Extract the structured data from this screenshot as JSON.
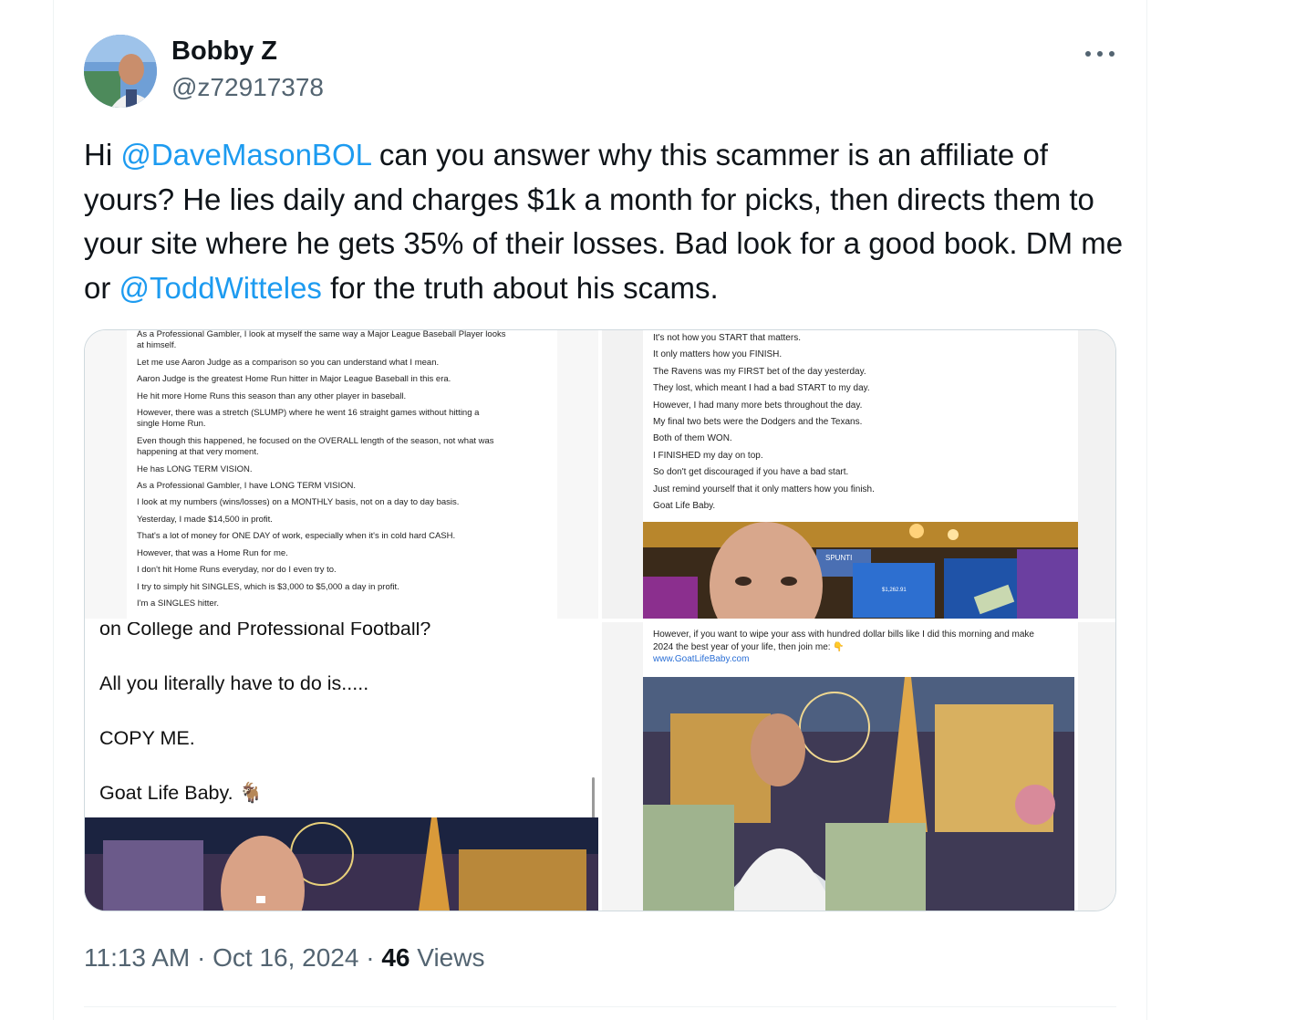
{
  "author": {
    "name": "Bobby Z",
    "handle": "@z72917378",
    "avatar_icon": "avatar-photo"
  },
  "tweet": {
    "text_before": "Hi ",
    "mention1": "@DaveMasonBOL",
    "text_middle": " can you answer why this scammer is an affiliate of yours? He lies daily and charges $1k a month for picks, then directs them to your site where he gets 35% of their losses. Bad look for a good book. DM me or ",
    "mention2": "@ToddWitteles",
    "text_after": " for the truth about his scams."
  },
  "media": {
    "image1_lines": [
      "As a Professional Gambler, I look at myself the same way a Major League Baseball Player looks",
      "at himself.",
      "Let me use Aaron Judge as a comparison so you can understand what I mean.",
      "Aaron Judge is the greatest Home Run hitter in Major League Baseball in this era.",
      "He hit more Home Runs this season than any other player in baseball.",
      "However, there was a stretch (SLUMP) where he went 16 straight games without hitting a",
      "single Home Run.",
      "Even though this happened, he focused on the OVERALL length of the season, not what was",
      "happening at that very moment.",
      "He has LONG TERM VISION.",
      "As a Professional Gambler, I have LONG TERM VISION.",
      "I look at my numbers (wins/losses) on a MONTHLY basis, not on a day to day basis.",
      "Yesterday, I made $14,500 in profit.",
      "That's a lot of money for ONE DAY of work, especially when it's in cold hard CASH.",
      "However, that was a Home Run for me.",
      "I don't hit Home Runs everyday, nor do I even try to.",
      "I try to simply hit SINGLES, which is $3,000 to $5,000 a day in profit.",
      "I'm a SINGLES hitter."
    ],
    "image2_lines": [
      "It's not how you START that matters.",
      "It only matters how you FINISH.",
      "The Ravens was my FIRST bet of the day yesterday.",
      "They lost, which meant I had a bad START to my day.",
      "However, I had many more bets throughout the day.",
      "My final two bets were the Dodgers and the Texans.",
      "Both of them WON.",
      "I FINISHED my day on top.",
      "So don't get discouraged if you have a bad start.",
      "Just remind yourself that it only matters how you finish.",
      "Goat Life Baby."
    ],
    "image2_sign": "SPUNTI",
    "image2_meter": "$1,262.91",
    "image3_lines": [
      "on College and Professional Football?",
      "All you literally have to do is.....",
      "COPY ME.",
      "Goat Life Baby."
    ],
    "image4_lines": [
      "However, if you want to wipe your ass with hundred dollar bills like I did this morning and make",
      "2024 the best year of your life, then join me:"
    ],
    "image4_link": "www.GoatLifeBaby.com"
  },
  "footer": {
    "time": "11:13 AM",
    "separator": " · ",
    "date": "Oct 16, 2024",
    "views_count": "46",
    "views_label": " Views"
  },
  "colors": {
    "accent": "#1d9bf0",
    "secondary_text": "#536471",
    "border": "#cfd9de"
  }
}
